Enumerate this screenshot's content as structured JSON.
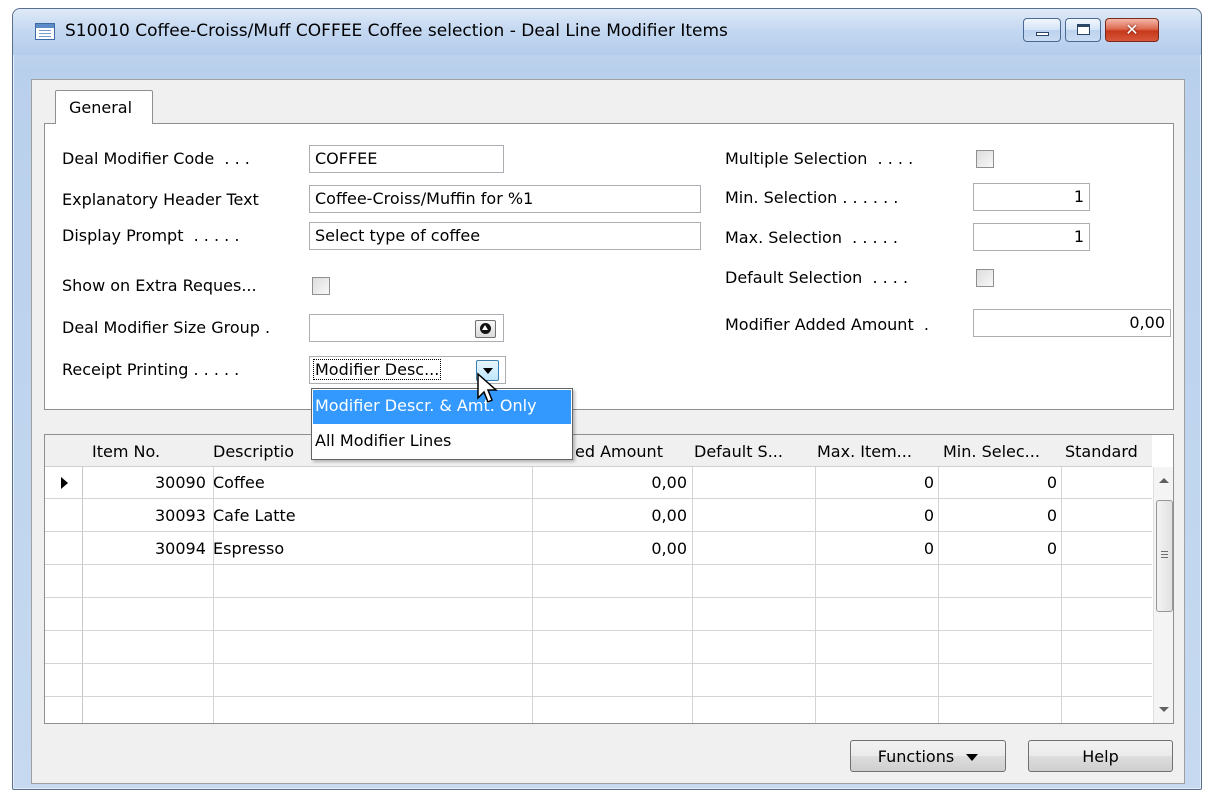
{
  "window": {
    "title": "S10010 Coffee-Croiss/Muff COFFEE Coffee selection - Deal Line Modifier Items",
    "icon": "form-icon",
    "close_glyph": "✕"
  },
  "tabs": [
    {
      "label": "General"
    }
  ],
  "form": {
    "deal_modifier_code": {
      "label": "Deal Modifier Code  . . .",
      "value": "COFFEE"
    },
    "explanatory_header_text": {
      "label": "Explanatory Header Text",
      "value": "Coffee-Croiss/Muffin for %1"
    },
    "display_prompt": {
      "label": "Display Prompt  . . . . .",
      "value": "Select type of coffee"
    },
    "show_on_extra_request": {
      "label": "Show on Extra Reques...",
      "checked": false
    },
    "deal_modifier_size_group": {
      "label": "Deal Modifier Size Group .",
      "value": ""
    },
    "receipt_printing": {
      "label": "Receipt Printing . . . . .",
      "value": "Modifier Desc..."
    },
    "multiple_selection": {
      "label": "Multiple Selection  . . . .",
      "checked": false
    },
    "min_selection": {
      "label": "Min. Selection . . . . . .",
      "value": "1"
    },
    "max_selection": {
      "label": "Max. Selection  . . . . .",
      "value": "1"
    },
    "default_selection": {
      "label": "Default Selection  . . . .",
      "checked": false
    },
    "modifier_added_amount": {
      "label": "Modifier Added Amount  .",
      "value": "0,00"
    }
  },
  "receipt_printing_options": {
    "items": [
      {
        "label": "Modifier Descr. & Amt. Only",
        "selected": true
      },
      {
        "label": "All Modifier Lines",
        "selected": false
      }
    ]
  },
  "grid": {
    "columns": [
      "Item No.",
      "Descriptio",
      "ed Amount",
      "Default S...",
      "Max. Item...",
      "Min. Selec...",
      "Standard"
    ],
    "rows": [
      {
        "item_no": "30090",
        "description": "Coffee",
        "amount": "0,00",
        "default_s": "",
        "max_items": "0",
        "min_selection": "0",
        "standard": ""
      },
      {
        "item_no": "30093",
        "description": "Cafe Latte",
        "amount": "0,00",
        "default_s": "",
        "max_items": "0",
        "min_selection": "0",
        "standard": ""
      },
      {
        "item_no": "30094",
        "description": "Espresso",
        "amount": "0,00",
        "default_s": "",
        "max_items": "0",
        "min_selection": "0",
        "standard": ""
      }
    ]
  },
  "buttons": {
    "functions": "Functions",
    "help": "Help"
  },
  "colors": {
    "selection_highlight": "#3399ff",
    "title_bar": "#c4d8f1",
    "close_button": "#c6391c"
  }
}
